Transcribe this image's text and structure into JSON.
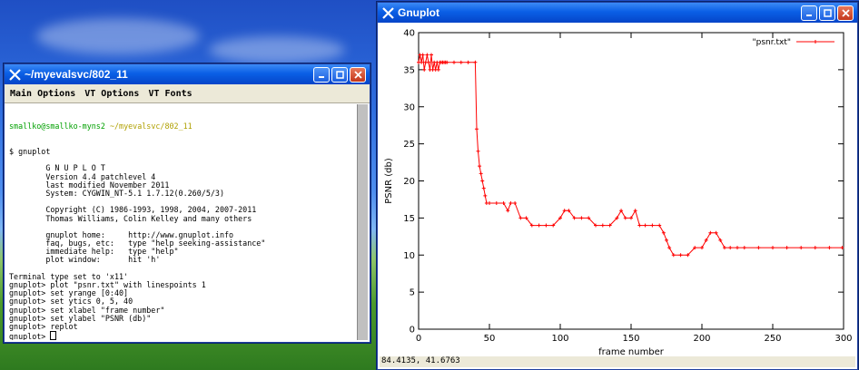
{
  "terminal": {
    "title": "~/myevalsvc/802_11",
    "menus": [
      "Main Options",
      "VT Options",
      "VT Fonts"
    ],
    "prompt_user": "smallko@smallko-myns2",
    "prompt_path": "~/myevalsvc/802_11",
    "lines": [
      "$ gnuplot",
      "",
      "        G N U P L O T",
      "        Version 4.4 patchlevel 4",
      "        last modified November 2011",
      "        System: CYGWIN_NT-5.1 1.7.12(0.260/5/3)",
      "",
      "        Copyright (C) 1986-1993, 1998, 2004, 2007-2011",
      "        Thomas Williams, Colin Kelley and many others",
      "",
      "        gnuplot home:     http://www.gnuplot.info",
      "        faq, bugs, etc:   type \"help seeking-assistance\"",
      "        immediate help:   type \"help\"",
      "        plot window:      hit 'h'",
      "",
      "Terminal type set to 'x11'",
      "gnuplot> plot \"psnr.txt\" with linespoints 1",
      "gnuplot> set yrange [0:40]",
      "gnuplot> set ytics 0, 5, 40",
      "gnuplot> set xlabel \"frame number\"",
      "gnuplot> set ylabel \"PSNR (db)\"",
      "gnuplot> replot",
      "gnuplot> "
    ]
  },
  "plot_window": {
    "title": "Gnuplot",
    "status": "84.4135,   41.6763"
  },
  "colors": {
    "series": "#ff0000",
    "titlebar": "#0a5fe6"
  },
  "chart_data": {
    "type": "line",
    "title": "",
    "xlabel": "frame number",
    "ylabel": "PSNR (db)",
    "xlim": [
      0,
      300
    ],
    "ylim": [
      0,
      40
    ],
    "xticks": [
      0,
      50,
      100,
      150,
      200,
      250,
      300
    ],
    "yticks": [
      0,
      5,
      10,
      15,
      20,
      25,
      30,
      35,
      40
    ],
    "legend_position": "top-right",
    "grid": false,
    "series": [
      {
        "name": "\"psnr.txt\"",
        "x": [
          0,
          1,
          2,
          3,
          4,
          5,
          6,
          7,
          8,
          9,
          10,
          11,
          12,
          13,
          14,
          15,
          16,
          17,
          18,
          19,
          20,
          25,
          30,
          35,
          40,
          41,
          42,
          43,
          44,
          45,
          46,
          47,
          48,
          50,
          55,
          60,
          63,
          65,
          68,
          72,
          76,
          80,
          85,
          90,
          95,
          100,
          103,
          106,
          110,
          115,
          120,
          125,
          130,
          135,
          140,
          143,
          146,
          150,
          153,
          156,
          160,
          165,
          170,
          173,
          175,
          177,
          180,
          185,
          190,
          195,
          200,
          203,
          206,
          210,
          213,
          216,
          220,
          225,
          230,
          240,
          250,
          260,
          270,
          280,
          290,
          299
        ],
        "y": [
          36,
          37,
          36,
          37,
          35,
          36,
          37,
          36,
          35,
          37,
          35,
          36,
          35,
          36,
          35,
          36,
          36,
          36,
          36,
          36,
          36,
          36,
          36,
          36,
          36,
          27,
          24,
          22,
          21,
          20,
          19,
          18,
          17,
          17,
          17,
          17,
          16,
          17,
          17,
          15,
          15,
          14,
          14,
          14,
          14,
          15,
          16,
          16,
          15,
          15,
          15,
          14,
          14,
          14,
          15,
          16,
          15,
          15,
          16,
          14,
          14,
          14,
          14,
          13,
          12,
          11,
          10,
          10,
          10,
          11,
          11,
          12,
          13,
          13,
          12,
          11,
          11,
          11,
          11,
          11,
          11,
          11,
          11,
          11,
          11,
          11
        ]
      }
    ]
  }
}
